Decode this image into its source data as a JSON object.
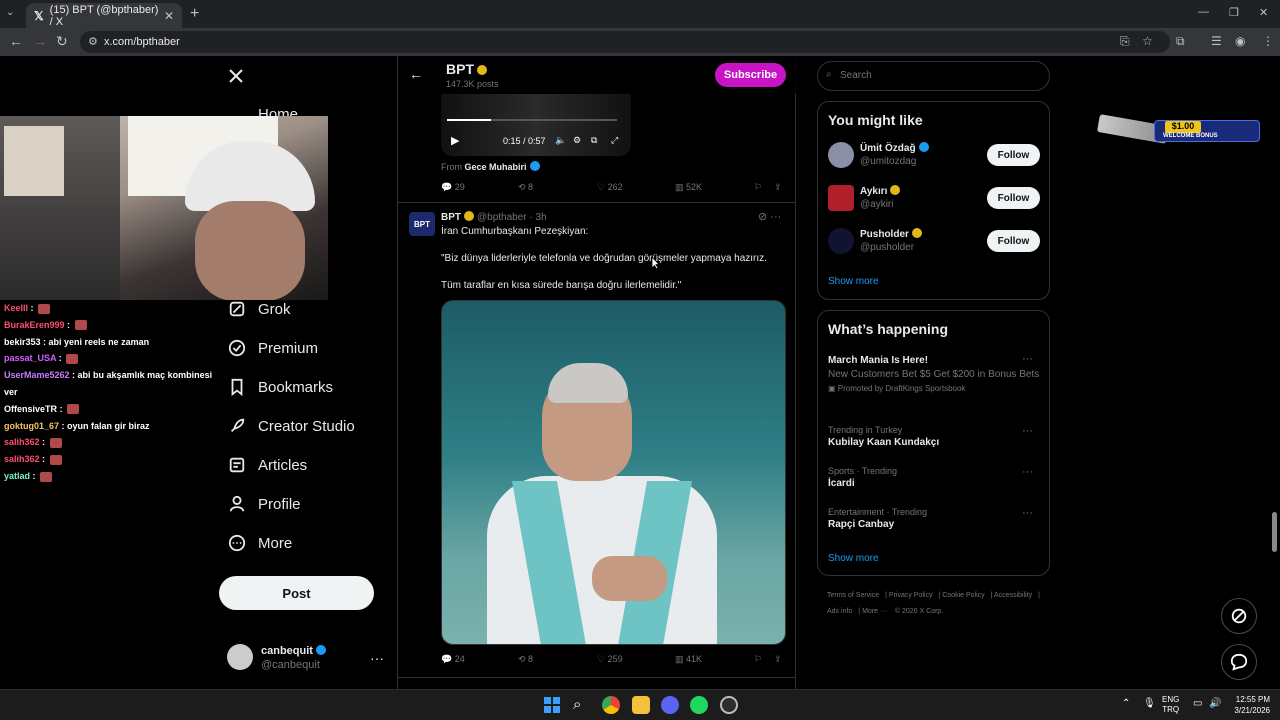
{
  "browser": {
    "tab_title": "(15) BPT (@bpthaber) / X",
    "url": "x.com/bpthaber"
  },
  "nav": {
    "home": "Home",
    "items": [
      "Grok",
      "Premium",
      "Bookmarks",
      "Creator Studio",
      "Articles",
      "Profile",
      "More"
    ],
    "post_button": "Post",
    "account_name": "canbequit",
    "account_handle": "@canbequit"
  },
  "profile_header": {
    "name": "BPT",
    "posts": "147.3K posts",
    "subscribe": "Subscribe"
  },
  "video_tweet": {
    "time": "0:15 / 0:57",
    "progress": 0.26,
    "from_label": "From",
    "from_name": "Gece Muhabiri",
    "replies": "29",
    "reposts": "8",
    "likes": "262",
    "views": "52K"
  },
  "tweet2": {
    "avatar_text": "BPT",
    "name": "BPT",
    "handle_time": "@bpthaber · 3h",
    "line1": "İran Cumhurbaşkanı Pezeşkiyan:",
    "line2": "\"Biz dünya liderleriyle telefonla ve doğrudan görüşmeler yapmaya hazırız.",
    "line3": "Tüm taraflar en kısa sürede barışa doğru ilerlemelidir.\"",
    "replies": "24",
    "reposts": "8",
    "likes": "259",
    "views": "41K"
  },
  "chat": [
    {
      "user": "Keelll",
      "msg": "",
      "color": "#ff4f6d"
    },
    {
      "user": "BurakEren999",
      "msg": "",
      "color": "#ff4f6d"
    },
    {
      "user": "bekir353",
      "msg": "abi yeni reels ne zaman",
      "color": "#ffffff"
    },
    {
      "user": "passat_USA",
      "msg": "",
      "color": "#d45fff"
    },
    {
      "user": "UserMame5262",
      "msg": "abi bu akşamlık maç kombinesi ver",
      "color": "#c77dff"
    },
    {
      "user": "OffensiveTR",
      "msg": "",
      "color": "#ffffff"
    },
    {
      "user": "goktug01_67",
      "msg": "oyun falan gir biraz",
      "color": "#f5c26b"
    },
    {
      "user": "salih362",
      "msg": "",
      "color": "#ff4f6d"
    },
    {
      "user": "salih362",
      "msg": "",
      "color": "#ff4f6d"
    },
    {
      "user": "yatlad",
      "msg": "",
      "color": "#7ff0c8"
    }
  ],
  "right": {
    "search_placeholder": "Search",
    "you_might_like": "You might like",
    "suggestions": [
      {
        "name": "Ümit Özdağ",
        "handle": "@umitozdag",
        "follow": "Follow"
      },
      {
        "name": "Aykırı",
        "handle": "@aykiri",
        "follow": "Follow"
      },
      {
        "name": "Pusholder",
        "handle": "@pusholder",
        "follow": "Follow"
      }
    ],
    "show_more": "Show more",
    "whats_happening": "What’s happening",
    "trends": [
      {
        "category": "",
        "title": "March Mania Is Here!",
        "desc": "New Customers Bet $5 Get $200 in Bonus Bets",
        "promo": "Promoted by DraftKings Sportsbook"
      },
      {
        "category": "Trending in Turkey",
        "title": "Kubilay Kaan Kundakçı",
        "desc": "",
        "promo": ""
      },
      {
        "category": "Sports · Trending",
        "title": "İcardi",
        "desc": "",
        "promo": ""
      },
      {
        "category": "Entertainment · Trending",
        "title": "Rapçi Canbay",
        "desc": "",
        "promo": ""
      }
    ],
    "footer": [
      "Terms of Service",
      "Privacy Policy",
      "Cookie Policy",
      "Accessibility",
      "Ads info",
      "More ···",
      "© 2026 X Corp."
    ]
  },
  "ad": {
    "amount": "$1.00",
    "text": "WELCOME BONUS"
  },
  "taskbar": {
    "lang1": "ENG",
    "lang2": "TRQ",
    "time": "12:55 PM",
    "date": "3/21/2026"
  },
  "colors": {
    "accent": "#1d9bf0",
    "subscribe": "#c914c5"
  }
}
